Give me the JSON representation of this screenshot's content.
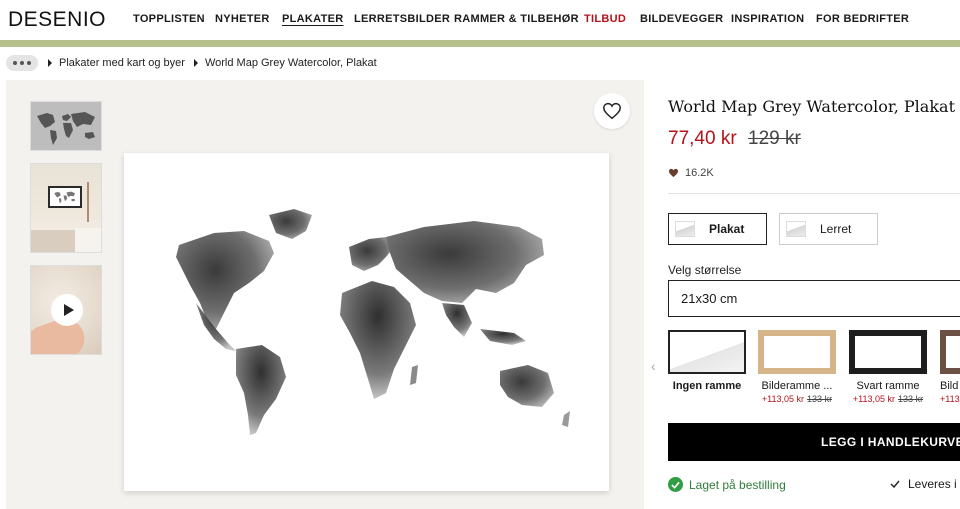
{
  "brand": {
    "logo": "DESENIO"
  },
  "nav": [
    {
      "label": "TOPPLISTEN"
    },
    {
      "label": "NYHETER"
    },
    {
      "label": "PLAKATER"
    },
    {
      "label": "LERRETSBILDER"
    },
    {
      "label": "RAMMER & TILBEHØR"
    },
    {
      "label": "TILBUD"
    },
    {
      "label": "BILDEVEGGER"
    },
    {
      "label": "INSPIRATION"
    },
    {
      "label": "FOR BEDRIFTER"
    }
  ],
  "colors": {
    "accent_sale": "#b3131b",
    "green_bar": "#b5c08c",
    "in_stock": "#2f7d3a"
  },
  "breadcrumb": [
    {
      "label": "Plakater med kart og byer"
    },
    {
      "label": "World Map Grey Watercolor, Plakat"
    }
  ],
  "product": {
    "title": "World Map Grey Watercolor, Plakat",
    "price": "77,40 kr",
    "old_price": "129 kr",
    "likes": "16.2K"
  },
  "types": [
    {
      "label": "Plakat",
      "selected": true
    },
    {
      "label": "Lerret",
      "selected": false
    }
  ],
  "size": {
    "label": "Velg størrelse",
    "value": "21x30 cm"
  },
  "frames": [
    {
      "name": "Ingen ramme",
      "add_price": "",
      "old_price": ""
    },
    {
      "name": "Bilderamme ...",
      "add_price": "+113,05 kr",
      "old_price": "133 kr"
    },
    {
      "name": "Svart ramme",
      "add_price": "+113,05 kr",
      "old_price": "133 kr"
    },
    {
      "name": "Bild",
      "add_price": "+113,",
      "old_price": ""
    }
  ],
  "cart": {
    "label": "LEGG I HANDLEKURVEN"
  },
  "stock": {
    "label": "Laget på bestilling"
  },
  "delivery": {
    "label": "Leveres i"
  }
}
